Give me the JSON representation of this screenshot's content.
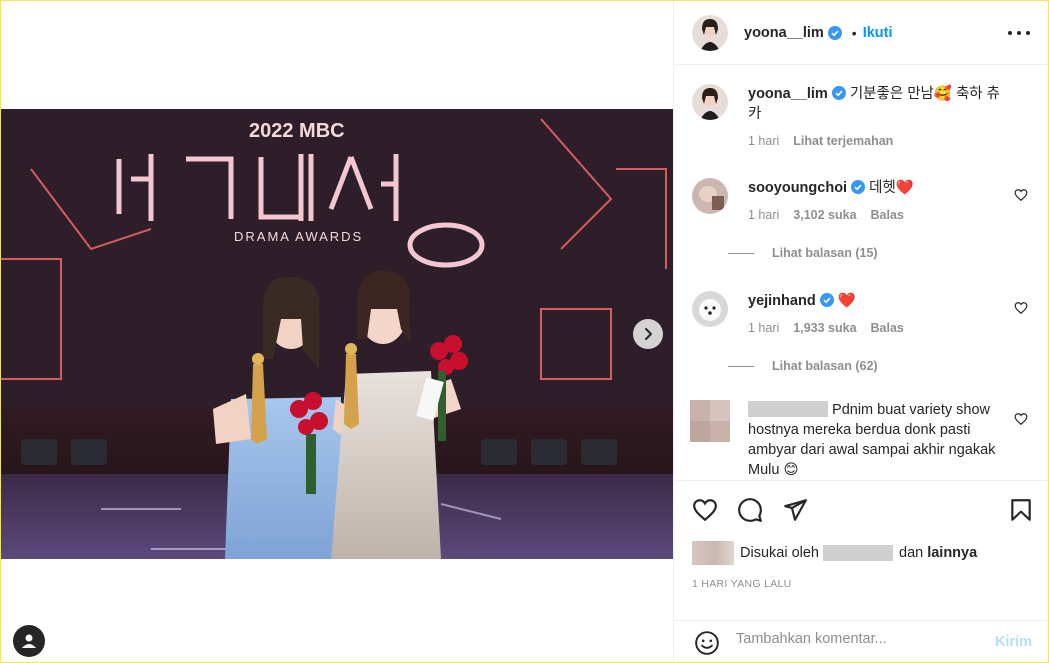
{
  "post": {
    "username": "yoona__lim",
    "follow_label": "Ikuti",
    "dot": "•",
    "caption": {
      "username": "yoona__lim",
      "text": "기분좋은 만남🥰 축하 츄카",
      "time": "1 hari",
      "translate_label": "Lihat terjemahan"
    }
  },
  "comments": [
    {
      "username": "sooyoungchoi",
      "text": "데헷❤️",
      "time": "1 hari",
      "likes": "3,102 suka",
      "reply_label": "Balas",
      "view_replies": "Lihat balasan (15)"
    },
    {
      "username": "yejinhand",
      "text": "❤️",
      "time": "1 hari",
      "likes": "1,933 suka",
      "reply_label": "Balas",
      "view_replies": "Lihat balasan (62)"
    },
    {
      "username": "",
      "text": "Pdnim buat variety show hostnya mereka berdua donk pasti ambyar dari awal sampai akhir ngakak Mulu 😊"
    }
  ],
  "likes": {
    "prefix": "Disukai oleh",
    "connector": "dan",
    "others": "lainnya"
  },
  "timestamp": "1 HARI YANG LALU",
  "add_comment": {
    "placeholder": "Tambahkan komentar...",
    "send_label": "Kirim"
  },
  "photo": {
    "year_brand": "2022 MBC",
    "subtitle": "DRAMA AWARDS"
  },
  "colors": {
    "link_blue": "#0095f6",
    "send_disabled": "#b2dffc",
    "heart_red": "#ed4956",
    "verified": "#3897f0"
  },
  "icons": [
    "heart-icon",
    "comment-icon",
    "share-icon",
    "bookmark-icon",
    "emoji-icon",
    "more-icon",
    "verified-badge-icon",
    "chevron-right-icon",
    "profile-icon"
  ]
}
